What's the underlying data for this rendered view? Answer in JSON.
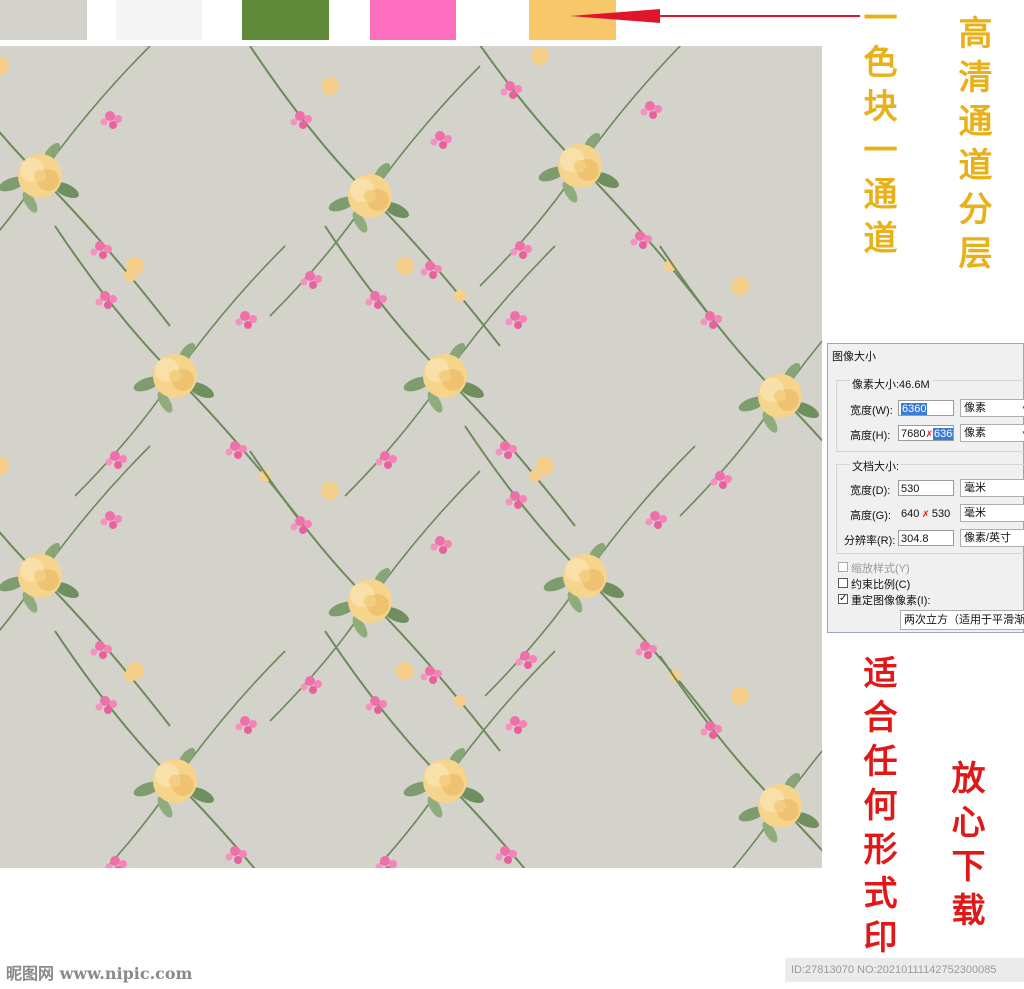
{
  "swatches": [
    "#d4d2cc",
    "#f4f4f4",
    "#5e8a3a",
    "#ff6fc0",
    "#f8c76a"
  ],
  "labels": {
    "one_block_one_channel": "一色块一通道",
    "hd_channel_layers": "高清通道分层",
    "suitable_any_print": "适合任何形式印",
    "download_freely": "放心下载"
  },
  "dialog": {
    "title": "图像大小",
    "pixel_size": "像素大小:46.6M",
    "width_label": "宽度(W):",
    "width_value": "6360",
    "width_unit": "像素",
    "height_label": "高度(H):",
    "height_old": "7680",
    "height_value": "6360",
    "height_unit": "像素",
    "doc_size": "文档大小:",
    "doc_width_label": "宽度(D):",
    "doc_width_value": "530",
    "doc_width_unit": "毫米",
    "doc_height_label": "高度(G):",
    "doc_height_old": "640",
    "doc_height_value": "530",
    "doc_height_unit": "毫米",
    "resolution_label": "分辨率(R):",
    "resolution_value": "304.8",
    "resolution_unit": "像素/英寸",
    "scale_styles": "缩放样式(Y)",
    "constrain": "约束比例(C)",
    "resample": "重定图像像素(I):",
    "resample_method": "两次立方（适用于平滑渐变"
  },
  "watermark_left": "昵图网 www.nipic.com",
  "watermark_right": "ID:27813070 NO:20210111142752300085"
}
